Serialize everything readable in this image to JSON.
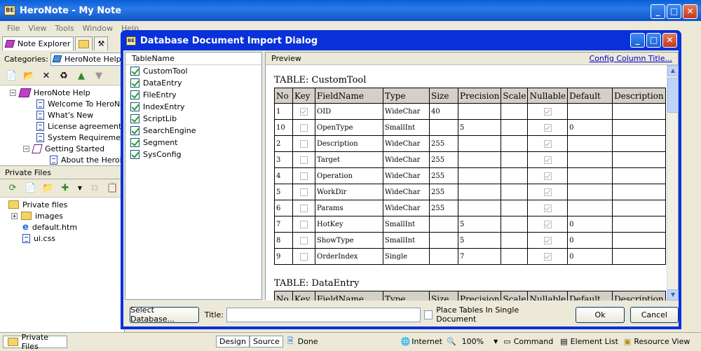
{
  "app": {
    "title": "HeroNote - My Note"
  },
  "menu": [
    "File",
    "View",
    "Tools",
    "Window",
    "Help"
  ],
  "left": {
    "tabs": [
      "Note Explorer"
    ],
    "categories_label": "Categories:",
    "categories_value": "HeroNote Help",
    "tree": [
      {
        "label": "HeroNote Help"
      },
      {
        "label": "Welcome To HeroNote"
      },
      {
        "label": "What's New"
      },
      {
        "label": "License agreement"
      },
      {
        "label": "System Requirements"
      },
      {
        "label": "Getting Started"
      },
      {
        "label": "About the HeroNote"
      }
    ],
    "private_header": "Private Files",
    "files": [
      {
        "label": "Private files"
      },
      {
        "label": "images"
      },
      {
        "label": "default.htm"
      },
      {
        "label": "ui.css"
      }
    ],
    "bottom_tab": "Private Files"
  },
  "status": {
    "design": "Design",
    "source": "Source",
    "done": "Done",
    "zone": "Internet",
    "zoom": "100%",
    "command": "Command",
    "element_list": "Element List",
    "resource_view": "Resource View"
  },
  "dialog": {
    "title": "Database Document Import Dialog",
    "list_header": "TableName",
    "tables": [
      {
        "name": "CustomTool",
        "checked": true
      },
      {
        "name": "DataEntry",
        "checked": true
      },
      {
        "name": "FileEntry",
        "checked": true
      },
      {
        "name": "IndexEntry",
        "checked": true
      },
      {
        "name": "ScriptLib",
        "checked": true
      },
      {
        "name": "SearchEngine",
        "checked": true
      },
      {
        "name": "Segment",
        "checked": true
      },
      {
        "name": "SysConfig",
        "checked": true
      }
    ],
    "preview_label": "Preview",
    "config_link": "Config Column Title...",
    "table1_title": "TABLE: CustomTool",
    "table2_title": "TABLE: DataEntry",
    "columns": [
      "No",
      "Key",
      "FieldName",
      "Type",
      "Size",
      "Precision",
      "Scale",
      "Nullable",
      "Default",
      "Description"
    ],
    "rows": [
      {
        "no": "1",
        "key": true,
        "field": "OID",
        "type": "WideChar",
        "size": "40",
        "precision": "",
        "scale": "",
        "nullable": true,
        "default": "",
        "desc": ""
      },
      {
        "no": "10",
        "key": false,
        "field": "OpenType",
        "type": "SmallInt",
        "size": "",
        "precision": "5",
        "scale": "",
        "nullable": true,
        "default": "0",
        "desc": ""
      },
      {
        "no": "2",
        "key": false,
        "field": "Description",
        "type": "WideChar",
        "size": "255",
        "precision": "",
        "scale": "",
        "nullable": true,
        "default": "",
        "desc": ""
      },
      {
        "no": "3",
        "key": false,
        "field": "Target",
        "type": "WideChar",
        "size": "255",
        "precision": "",
        "scale": "",
        "nullable": true,
        "default": "",
        "desc": ""
      },
      {
        "no": "4",
        "key": false,
        "field": "Operation",
        "type": "WideChar",
        "size": "255",
        "precision": "",
        "scale": "",
        "nullable": true,
        "default": "",
        "desc": ""
      },
      {
        "no": "5",
        "key": false,
        "field": "WorkDir",
        "type": "WideChar",
        "size": "255",
        "precision": "",
        "scale": "",
        "nullable": true,
        "default": "",
        "desc": ""
      },
      {
        "no": "6",
        "key": false,
        "field": "Params",
        "type": "WideChar",
        "size": "255",
        "precision": "",
        "scale": "",
        "nullable": true,
        "default": "",
        "desc": ""
      },
      {
        "no": "7",
        "key": false,
        "field": "HotKey",
        "type": "SmallInt",
        "size": "",
        "precision": "5",
        "scale": "",
        "nullable": true,
        "default": "0",
        "desc": ""
      },
      {
        "no": "8",
        "key": false,
        "field": "ShowType",
        "type": "SmallInt",
        "size": "",
        "precision": "5",
        "scale": "",
        "nullable": true,
        "default": "0",
        "desc": ""
      },
      {
        "no": "9",
        "key": false,
        "field": "OrderIndex",
        "type": "Single",
        "size": "",
        "precision": "7",
        "scale": "",
        "nullable": true,
        "default": "0",
        "desc": ""
      }
    ],
    "select_db": "Select Database...",
    "title_label": "Title:",
    "title_value": "",
    "single_doc": "Place Tables In Single Document",
    "ok": "Ok",
    "cancel": "Cancel"
  }
}
